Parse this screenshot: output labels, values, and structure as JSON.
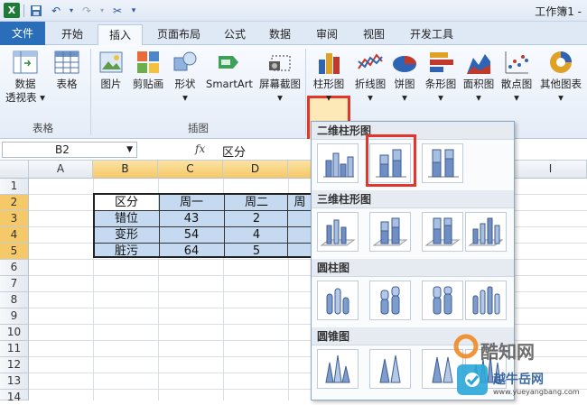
{
  "window": {
    "title": "工作簿1 -"
  },
  "tabs": [
    "文件",
    "开始",
    "插入",
    "页面布局",
    "公式",
    "数据",
    "审阅",
    "视图",
    "开发工具"
  ],
  "ribbon": {
    "pivot_label1": "数据",
    "pivot_label2": "透视表",
    "table_label": "表格",
    "picture_label": "图片",
    "clipart_label": "剪贴画",
    "shapes_label": "形状",
    "smartart_label": "SmartArt",
    "screenshot_label": "屏幕截图",
    "column_label": "柱形图",
    "line_label": "折线图",
    "pie_label": "饼图",
    "bar_label": "条形图",
    "area_label": "面积图",
    "scatter_label": "散点图",
    "other_label": "其他图表",
    "group_tables": "表格",
    "group_illustrations": "插图"
  },
  "formula_bar": {
    "name_box": "B2",
    "fx": "fx",
    "content": "区分"
  },
  "columns": [
    "A",
    "B",
    "C",
    "D",
    "I"
  ],
  "rows": [
    "1",
    "2",
    "3",
    "4",
    "5",
    "6",
    "7",
    "8",
    "9",
    "10",
    "11",
    "12",
    "13",
    "14"
  ],
  "table": {
    "header": [
      "区分",
      "周一",
      "周二",
      "周"
    ],
    "rows": [
      [
        "错位",
        "43",
        "2"
      ],
      [
        "变形",
        "54",
        "4"
      ],
      [
        "脏污",
        "64",
        "5"
      ]
    ]
  },
  "gallery": {
    "sections": [
      "二维柱形图",
      "三维柱形图",
      "圆柱图",
      "圆锥图"
    ]
  },
  "watermark": {
    "brand": "酷知网",
    "url_text": "www.yueyangbang.com",
    "brand2": "越牛岳网"
  },
  "colors": {
    "file_tab": "#2a6db8",
    "highlight": "#e0362c",
    "selected_header": "#f5c967"
  }
}
